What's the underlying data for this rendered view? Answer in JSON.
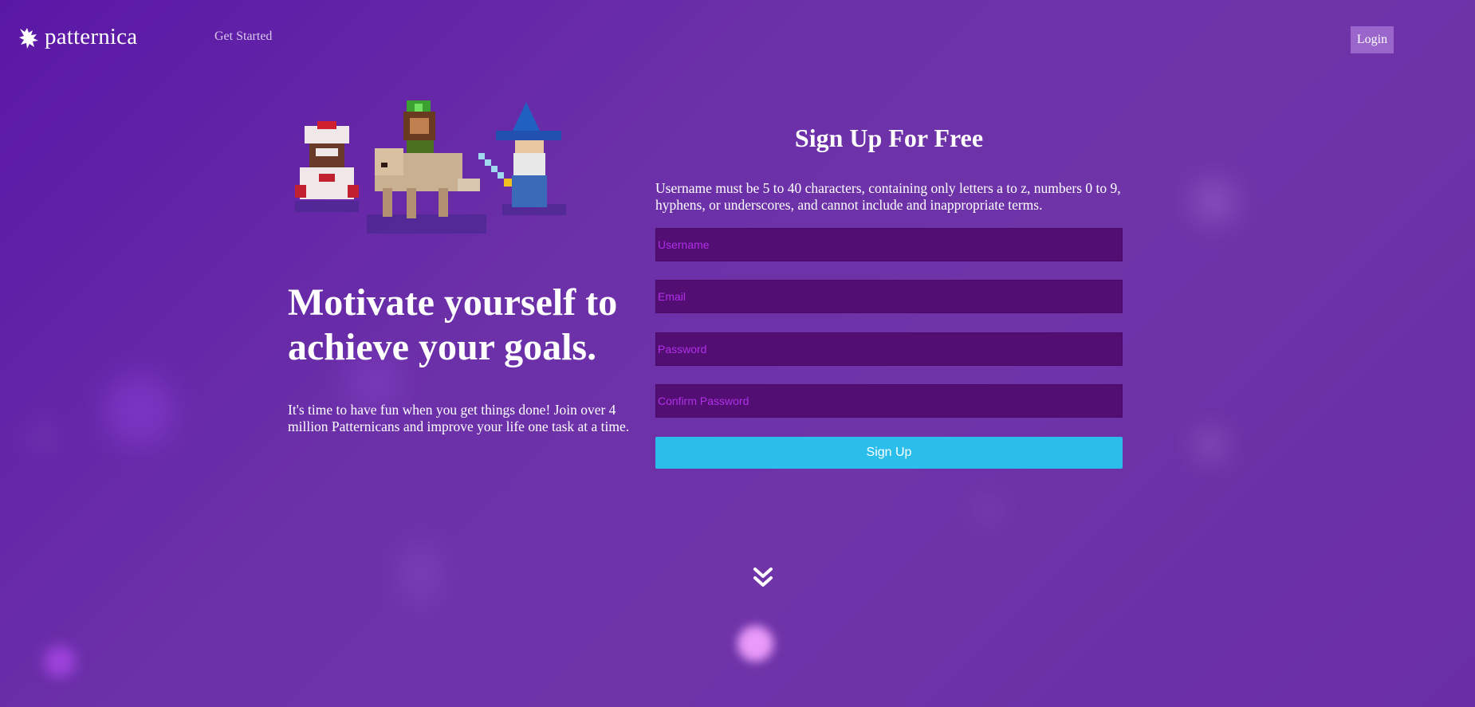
{
  "header": {
    "brand": "patternica",
    "nav_get_started": "Get Started",
    "login_label": "Login"
  },
  "hero": {
    "title": "Motivate yourself to achieve your goals.",
    "subtitle": "It's time to have fun when you get things done! Join over 4 million Patternicans and improve your life one task at a time."
  },
  "signup": {
    "title": "Sign Up For Free",
    "note": "Username must be 5 to 40 characters, containing only letters a to z, numbers 0 to 9, hyphens, or underscores, and cannot include and inappropriate terms.",
    "username_placeholder": "Username",
    "email_placeholder": "Email",
    "password_placeholder": "Password",
    "confirm_password_placeholder": "Confirm Password",
    "submit_label": "Sign Up"
  },
  "icons": {
    "logo": "gryphon-icon",
    "scroll": "double-chevron-down-icon"
  },
  "colors": {
    "background": "#6a2da5",
    "input_bg": "#520e72",
    "input_placeholder": "#b030e8",
    "signup_button": "#2bbeeb",
    "login_button": "#9a66cc"
  }
}
